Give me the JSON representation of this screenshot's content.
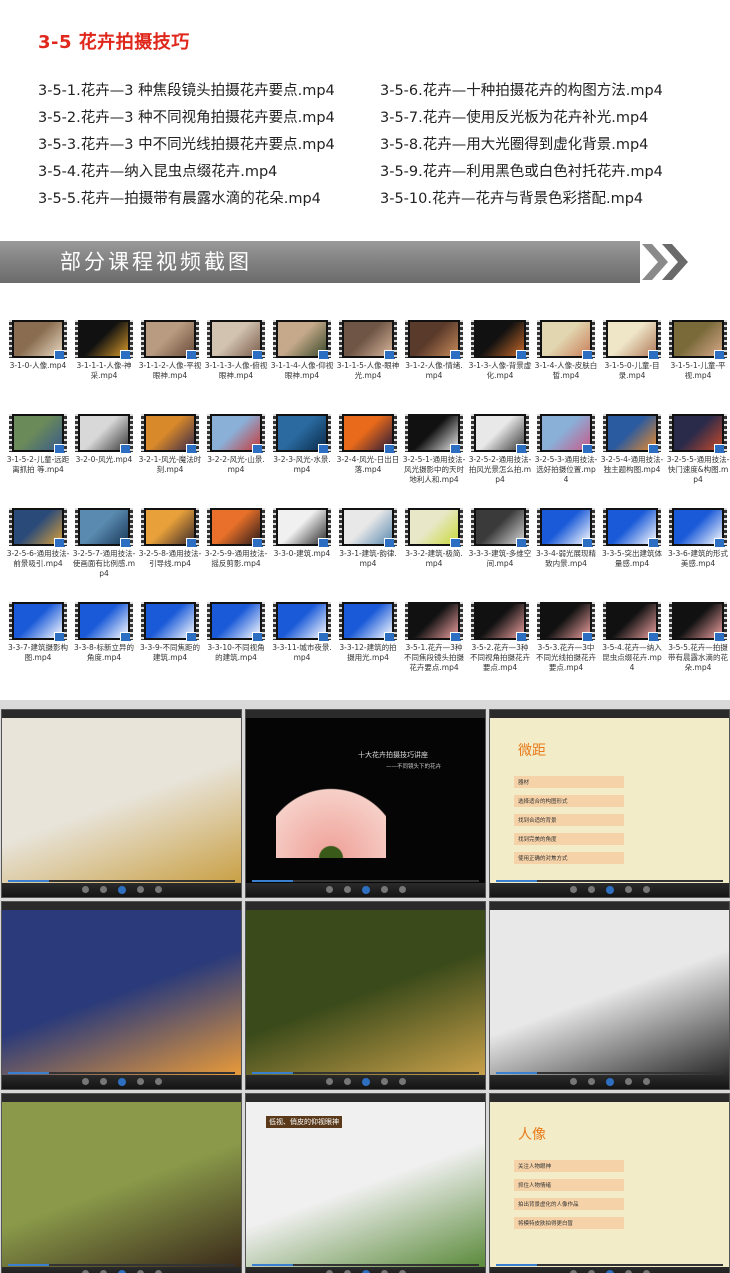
{
  "section": {
    "title": "3-5  花卉拍摄技巧"
  },
  "files": {
    "left": [
      "3-5-1.花卉—3 种焦段镜头拍摄花卉要点.mp4",
      "3-5-2.花卉—3 种不同视角拍摄花卉要点.mp4",
      "3-5-3.花卉—3 中不同光线拍摄花卉要点.mp4",
      "3-5-4.花卉—纳入昆虫点缀花卉.mp4",
      "3-5-5.花卉—拍摄带有晨露水滴的花朵.mp4"
    ],
    "right": [
      "3-5-6.花卉—十种拍摄花卉的构图方法.mp4",
      "3-5-7.花卉—使用反光板为花卉补光.mp4",
      "3-5-8.花卉—用大光圈得到虚化背景.mp4",
      "3-5-9.花卉—利用黑色或白色衬托花卉.mp4",
      "3-5-10.花卉—花卉与背景色彩搭配.mp4"
    ]
  },
  "banner": {
    "text": "部分课程视频截图"
  },
  "thumbnails": [
    {
      "label": "3-1-0-人像.mp4",
      "c1": "#8a6d50",
      "c2": "#e8d9c2"
    },
    {
      "label": "3-1-1-1-人像-神采.mp4",
      "c1": "#111111",
      "c2": "#d89a2a"
    },
    {
      "label": "3-1-1-2-人像-平视眼神.mp4",
      "c1": "#b89b80",
      "c2": "#6a4c3a"
    },
    {
      "label": "3-1-1-3-人像-俯视眼神.mp4",
      "c1": "#d2c2b0",
      "c2": "#7b5d4c"
    },
    {
      "label": "3-1-1-4-人像-仰视眼神.mp4",
      "c1": "#c5a98a",
      "c2": "#3a4a2a"
    },
    {
      "label": "3-1-1-5-人像-眼神光.mp4",
      "c1": "#6e5545",
      "c2": "#d7b59b"
    },
    {
      "label": "3-1-2-人像-情绪.mp4",
      "c1": "#5a3a2a",
      "c2": "#c68a5a"
    },
    {
      "label": "3-1-3-人像-背景虚化.mp4",
      "c1": "#111111",
      "c2": "#c96a2a"
    },
    {
      "label": "3-1-4-人像-皮肤白皙.mp4",
      "c1": "#e2d6b0",
      "c2": "#c87f5a"
    },
    {
      "label": "3-1-5-0-儿童-目录.mp4",
      "c1": "#efe6c8",
      "c2": "#b07a5a"
    },
    {
      "label": "3-1-5-1-儿童-平视.mp4",
      "c1": "#7a6a3a",
      "c2": "#d8a98a"
    },
    {
      "label": "3-1-5-2-儿童-远距离抓拍 等.mp4",
      "c1": "#6a8a5a",
      "c2": "#3a5a8a"
    },
    {
      "label": "3-2-0-风光.mp4",
      "c1": "#d8d8d8",
      "c2": "#3a3a3a"
    },
    {
      "label": "3-2-1-风光-魔法时刻.mp4",
      "c1": "#d8892a",
      "c2": "#3a2a4a"
    },
    {
      "label": "3-2-2-风光-山景.mp4",
      "c1": "#8ab0d8",
      "c2": "#c83a3a"
    },
    {
      "label": "3-2-3-风光-水景.mp4",
      "c1": "#2a6aa0",
      "c2": "#0a2a4a"
    },
    {
      "label": "3-2-4-风光-日出日落.mp4",
      "c1": "#e86a1a",
      "c2": "#2a1a3a"
    },
    {
      "label": "3-2-5-1-通用技法-风光摄影中的天时地利人和.mp4",
      "c1": "#111111",
      "c2": "#e8e8e8"
    },
    {
      "label": "3-2-5-2-通用技法-拍风光景怎么拍.mp4",
      "c1": "#e8e8e8",
      "c2": "#3a3a3a"
    },
    {
      "label": "3-2-5-3-通用技法-选好拍摄位置.mp4",
      "c1": "#8ab0d8",
      "c2": "#c85a8a"
    },
    {
      "label": "3-2-5-4-通用技法-独主题构图.mp4",
      "c1": "#2a5aa0",
      "c2": "#e88a2a"
    },
    {
      "label": "3-2-5-5-通用技法-快门速度&构图.mp4",
      "c1": "#2a2a4a",
      "c2": "#c84a2a"
    },
    {
      "label": "3-2-5-6-通用技法-前景吸引.mp4",
      "c1": "#2a4a7a",
      "c2": "#d8a03a"
    },
    {
      "label": "3-2-5-7-通用技法-使画面有比例感.mp4",
      "c1": "#5a8ab0",
      "c2": "#1a3a5a"
    },
    {
      "label": "3-2-5-8-通用技法-引导线.mp4",
      "c1": "#e8a03a",
      "c2": "#3a2a2a"
    },
    {
      "label": "3-2-5-9-通用技法-摇反剪影.mp4",
      "c1": "#e8702a",
      "c2": "#2a1a1a"
    },
    {
      "label": "3-3-0-建筑.mp4",
      "c1": "#f0f0f0",
      "c2": "#2a2a2a"
    },
    {
      "label": "3-3-1-建筑-韵律.mp4",
      "c1": "#e8e8e8",
      "c2": "#5a8ab0"
    },
    {
      "label": "3-3-2-建筑-极简.mp4",
      "c1": "#e8e8c8",
      "c2": "#c8d83a"
    },
    {
      "label": "3-3-3-建筑-多维空间.mp4",
      "c1": "#3a3a3a",
      "c2": "#d8d8d8"
    },
    {
      "label": "3-3-4-弱光展现精致内景.mp4",
      "c1": "#1a5ad8",
      "c2": "#ffffff"
    },
    {
      "label": "3-3-5-突出建筑体量感.mp4",
      "c1": "#1a5ad8",
      "c2": "#ffffff"
    },
    {
      "label": "3-3-6-建筑的形式美感.mp4",
      "c1": "#1a5ad8",
      "c2": "#ffffff"
    },
    {
      "label": "3-3-7-建筑摄影构图.mp4",
      "c1": "#1a5ad8",
      "c2": "#ffffff"
    },
    {
      "label": "3-3-8-标新立异的角度.mp4",
      "c1": "#1a5ad8",
      "c2": "#ffffff"
    },
    {
      "label": "3-3-9-不同焦距的建筑.mp4",
      "c1": "#1a5ad8",
      "c2": "#ffffff"
    },
    {
      "label": "3-3-10-不同视角的建筑.mp4",
      "c1": "#1a5ad8",
      "c2": "#ffffff"
    },
    {
      "label": "3-3-11-城市夜景.mp4",
      "c1": "#1a5ad8",
      "c2": "#ffffff"
    },
    {
      "label": "3-3-12-建筑的拍摄用光.mp4",
      "c1": "#1a5ad8",
      "c2": "#ffffff"
    },
    {
      "label": "3-5-1.花卉—3种不同焦段镜头拍摄花卉要点.mp4",
      "c1": "#111111",
      "c2": "#f0a0a0"
    },
    {
      "label": "3-5-2.花卉—3种不同视角拍摄花卉要点.mp4",
      "c1": "#111111",
      "c2": "#f0a0a0"
    },
    {
      "label": "3-5-3.花卉—3中不同光线拍摄花卉要点.mp4",
      "c1": "#111111",
      "c2": "#f0a0a0"
    },
    {
      "label": "3-5-4.花卉—纳入昆虫点缀花卉.mp4",
      "c1": "#111111",
      "c2": "#f0a0a0"
    },
    {
      "label": "3-5-5.花卉—拍摄带有晨露水滴的花朵.mp4",
      "c1": "#111111",
      "c2": "#f0a0a0"
    }
  ],
  "screenshots": [
    {
      "name": "shot-architecture",
      "bg1": "#e8e4da",
      "bg2": "#c9a045",
      "title": "",
      "lines": []
    },
    {
      "name": "shot-flower-lecture",
      "bg1": "#050505",
      "bg2": "#f0a8a0",
      "title": "十大花卉拍摄技巧讲座",
      "lines": [
        "——不同镜头下的花卉"
      ]
    },
    {
      "name": "shot-macro-menu",
      "bg1": "#f3ecc8",
      "bg2": "#e8a03a",
      "title": "微距",
      "lines": [
        "器材",
        "选择适合的构图形式",
        "找到合适的背景",
        "找到完美的角度",
        "使用正确的对焦方式"
      ]
    },
    {
      "name": "shot-city-night",
      "bg1": "#2a3a7a",
      "bg2": "#e89a3a",
      "title": "",
      "lines": []
    },
    {
      "name": "shot-waterfall",
      "bg1": "#3a4a1a",
      "bg2": "#c8a04a",
      "title": "",
      "lines": []
    },
    {
      "name": "shot-studio-presenter",
      "bg1": "#e8e8e8",
      "bg2": "#2a2a2a",
      "title": "",
      "lines": []
    },
    {
      "name": "shot-birds",
      "bg1": "#8a9a4a",
      "bg2": "#3a2a1a",
      "title": "",
      "lines": []
    },
    {
      "name": "shot-portrait-eyes",
      "bg1": "#f0f0f0",
      "bg2": "#5a8a3a",
      "title": "低视、俏皮的仰视眼神",
      "lines": []
    },
    {
      "name": "shot-portrait-menu",
      "bg1": "#f3ecc8",
      "bg2": "#e8a03a",
      "title": "人像",
      "lines": [
        "关注人物眼神",
        "抓住人物情绪",
        "拍出背景虚化的人像作品",
        "将模特皮肤拍得更白皙"
      ]
    }
  ]
}
